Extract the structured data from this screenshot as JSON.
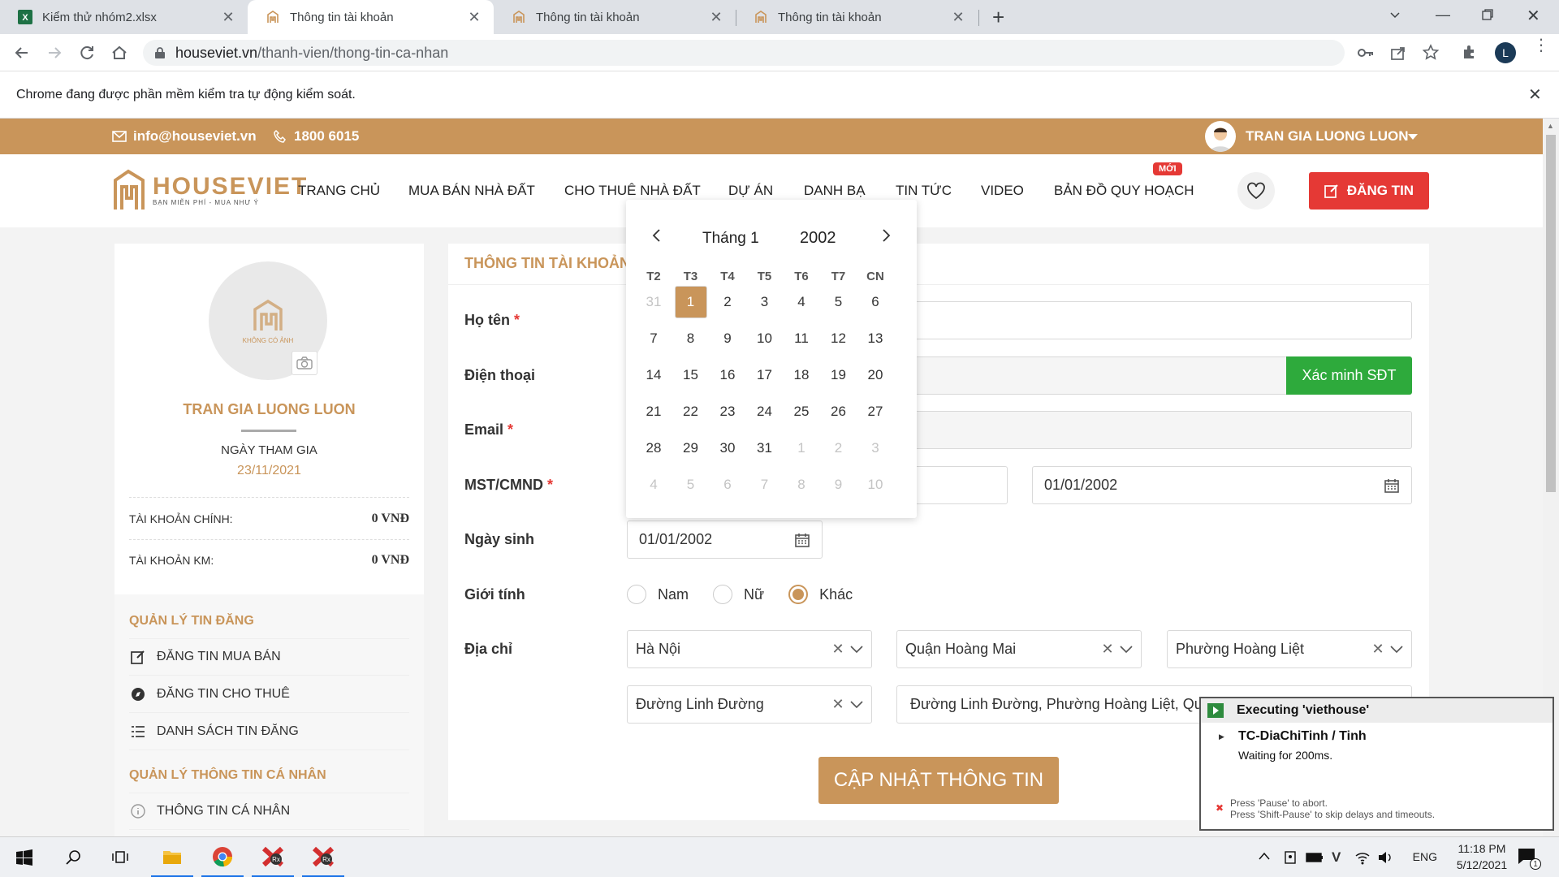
{
  "browser": {
    "tabs": [
      {
        "title": "Kiểm thử nhóm2.xlsx",
        "icon": "excel-icon"
      },
      {
        "title": "Thông tin tài khoản",
        "icon": "houseviet-favicon"
      },
      {
        "title": "Thông tin tài khoản",
        "icon": "houseviet-favicon"
      },
      {
        "title": "Thông tin tài khoản",
        "icon": "houseviet-favicon"
      }
    ],
    "active_tab": 1,
    "url_domain": "houseviet.vn",
    "url_path": "/thanh-vien/thong-tin-ca-nhan",
    "infobar_text": "Chrome đang được phần mềm kiểm tra tự động kiểm soát.",
    "profile_initial": "L"
  },
  "site": {
    "topbar": {
      "email": "info@houseviet.vn",
      "phone": "1800 6015",
      "username": "TRAN GIA LUONG LUON"
    },
    "logo": {
      "name": "HOUSEVIET",
      "tagline": "BẠN MIỄN PHÍ - MUA NHƯ Ý"
    },
    "nav": [
      "TRANG CHỦ",
      "MUA BÁN NHÀ ĐẤT",
      "CHO THUÊ NHÀ ĐẤT",
      "DỰ ÁN",
      "DANH BẠ",
      "TIN TỨC",
      "VIDEO",
      "BẢN ĐỒ QUY HOẠCH"
    ],
    "new_badge": "MỚI",
    "post_button": "ĐĂNG TIN",
    "brand_color": "#c9955a"
  },
  "sidebar": {
    "avatar_text": "KHÔNG CÓ ẢNH",
    "username": "TRAN GIA LUONG LUON",
    "join_label": "NGÀY THAM GIA",
    "join_date": "23/11/2021",
    "main_account_label": "TÀI KHOẢN CHÍNH:",
    "main_account_value": "0 VNĐ",
    "promo_account_label": "TÀI KHOẢN KM:",
    "promo_account_value": "0 VNĐ",
    "section_posts": "QUẢN LÝ TIN ĐĂNG",
    "post_links": [
      "ĐĂNG TIN MUA BÁN",
      "ĐĂNG TIN CHO THUÊ",
      "DANH SÁCH TIN ĐĂNG"
    ],
    "section_personal": "QUẢN LÝ THÔNG TIN CÁ NHÂN",
    "personal_links": [
      "THÔNG TIN CÁ NHÂN"
    ]
  },
  "form": {
    "title": "THÔNG TIN TÀI KHOẢN",
    "labels": {
      "name": "Họ tên",
      "phone": "Điện thoại",
      "email": "Email",
      "id": "MST/CMND",
      "dob": "Ngày sinh",
      "gender": "Giới tính",
      "address": "Địa chỉ"
    },
    "required_mark": "*",
    "verify_button": "Xác minh SĐT",
    "id_date": "01/01/2002",
    "dob_value": "01/01/2002",
    "gender_options": [
      "Nam",
      "Nữ",
      "Khác"
    ],
    "gender_selected": "Khác",
    "city": "Hà Nội",
    "district": "Quận Hoàng Mai",
    "ward": "Phường Hoàng Liệt",
    "street": "Đường Linh Đường",
    "full_address": "Đường Linh Đường, Phường Hoàng Liệt, Quận Hoàng Mai, Hà Nội",
    "submit_button": "CẬP NHẬT THÔNG TIN"
  },
  "datepicker": {
    "month": "Tháng 1",
    "year": "2002",
    "weekdays": [
      "T2",
      "T3",
      "T4",
      "T5",
      "T6",
      "T7",
      "CN"
    ],
    "days": [
      [
        {
          "d": "31",
          "m": true
        },
        {
          "d": "1",
          "s": true
        },
        {
          "d": "2"
        },
        {
          "d": "3"
        },
        {
          "d": "4"
        },
        {
          "d": "5"
        },
        {
          "d": "6"
        }
      ],
      [
        {
          "d": "7"
        },
        {
          "d": "8"
        },
        {
          "d": "9"
        },
        {
          "d": "10"
        },
        {
          "d": "11"
        },
        {
          "d": "12"
        },
        {
          "d": "13"
        }
      ],
      [
        {
          "d": "14"
        },
        {
          "d": "15"
        },
        {
          "d": "16"
        },
        {
          "d": "17"
        },
        {
          "d": "18"
        },
        {
          "d": "19"
        },
        {
          "d": "20"
        }
      ],
      [
        {
          "d": "21"
        },
        {
          "d": "22"
        },
        {
          "d": "23"
        },
        {
          "d": "24"
        },
        {
          "d": "25"
        },
        {
          "d": "26"
        },
        {
          "d": "27"
        }
      ],
      [
        {
          "d": "28"
        },
        {
          "d": "29"
        },
        {
          "d": "30"
        },
        {
          "d": "31"
        },
        {
          "d": "1",
          "m": true
        },
        {
          "d": "2",
          "m": true
        },
        {
          "d": "3",
          "m": true
        }
      ],
      [
        {
          "d": "4",
          "m": true
        },
        {
          "d": "5",
          "m": true
        },
        {
          "d": "6",
          "m": true
        },
        {
          "d": "7",
          "m": true
        },
        {
          "d": "8",
          "m": true
        },
        {
          "d": "9",
          "m": true
        },
        {
          "d": "10",
          "m": true
        }
      ]
    ]
  },
  "ranorex": {
    "executing": "Executing 'viethouse'",
    "step": "TC-DiaChiTinh / Tinh",
    "waiting": "Waiting for 200ms.",
    "hint1": "Press 'Pause' to abort.",
    "hint2": "Press 'Shift-Pause' to skip delays and timeouts."
  },
  "taskbar": {
    "language": "ENG",
    "time": "11:18 PM",
    "date": "5/12/2021",
    "notification_count": "1"
  }
}
